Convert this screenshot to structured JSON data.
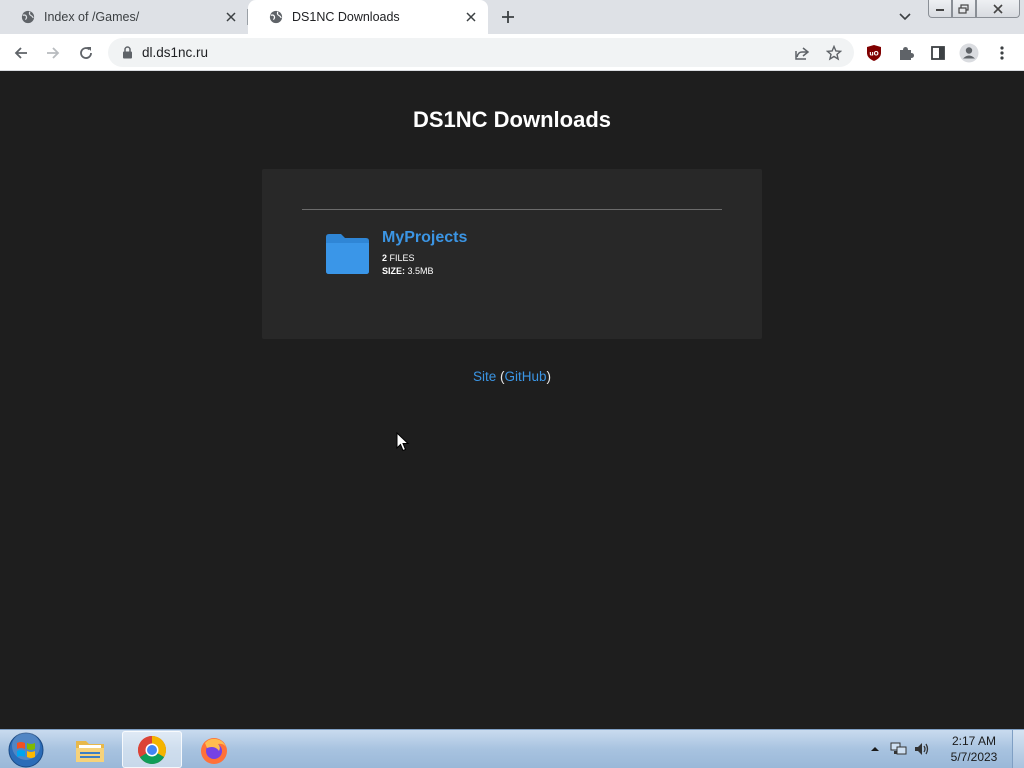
{
  "browser": {
    "tabs": [
      {
        "title": "Index of /Games/",
        "active": false
      },
      {
        "title": "DS1NC Downloads",
        "active": true
      }
    ],
    "url": "dl.ds1nc.ru",
    "icons": {
      "tab_favicon": "globe-icon",
      "new_tab": "plus-icon",
      "tab_search": "chevron-down-icon",
      "back": "arrow-left-icon",
      "forward": "arrow-right-icon",
      "reload": "reload-icon",
      "lock": "lock-icon",
      "share": "share-icon",
      "bookmark": "star-icon",
      "extension_ublock": "ublock-icon",
      "extensions": "puzzle-icon",
      "side_panel": "side-panel-icon",
      "profile": "profile-icon",
      "menu": "kebab-menu-icon"
    }
  },
  "page": {
    "title": "DS1NC Downloads",
    "folders": [
      {
        "name": "MyProjects",
        "file_count": "2",
        "files_label": "FILES",
        "size_label": "SIZE:",
        "size_value": "3.5MB"
      }
    ],
    "footer": {
      "site_link": "Site",
      "open_paren": "(",
      "github_link": "GitHub",
      "close_paren": ")"
    }
  },
  "taskbar": {
    "apps": [
      "windows-explorer",
      "google-chrome",
      "firefox"
    ],
    "clock": {
      "time": "2:17 AM",
      "date": "5/7/2023"
    }
  },
  "colors": {
    "page_background": "#1e1e1e",
    "panel_background": "#282828",
    "link_blue": "#3b95e4",
    "folder_blue": "#2f86d6",
    "tab_strip": "#dee1e6"
  }
}
